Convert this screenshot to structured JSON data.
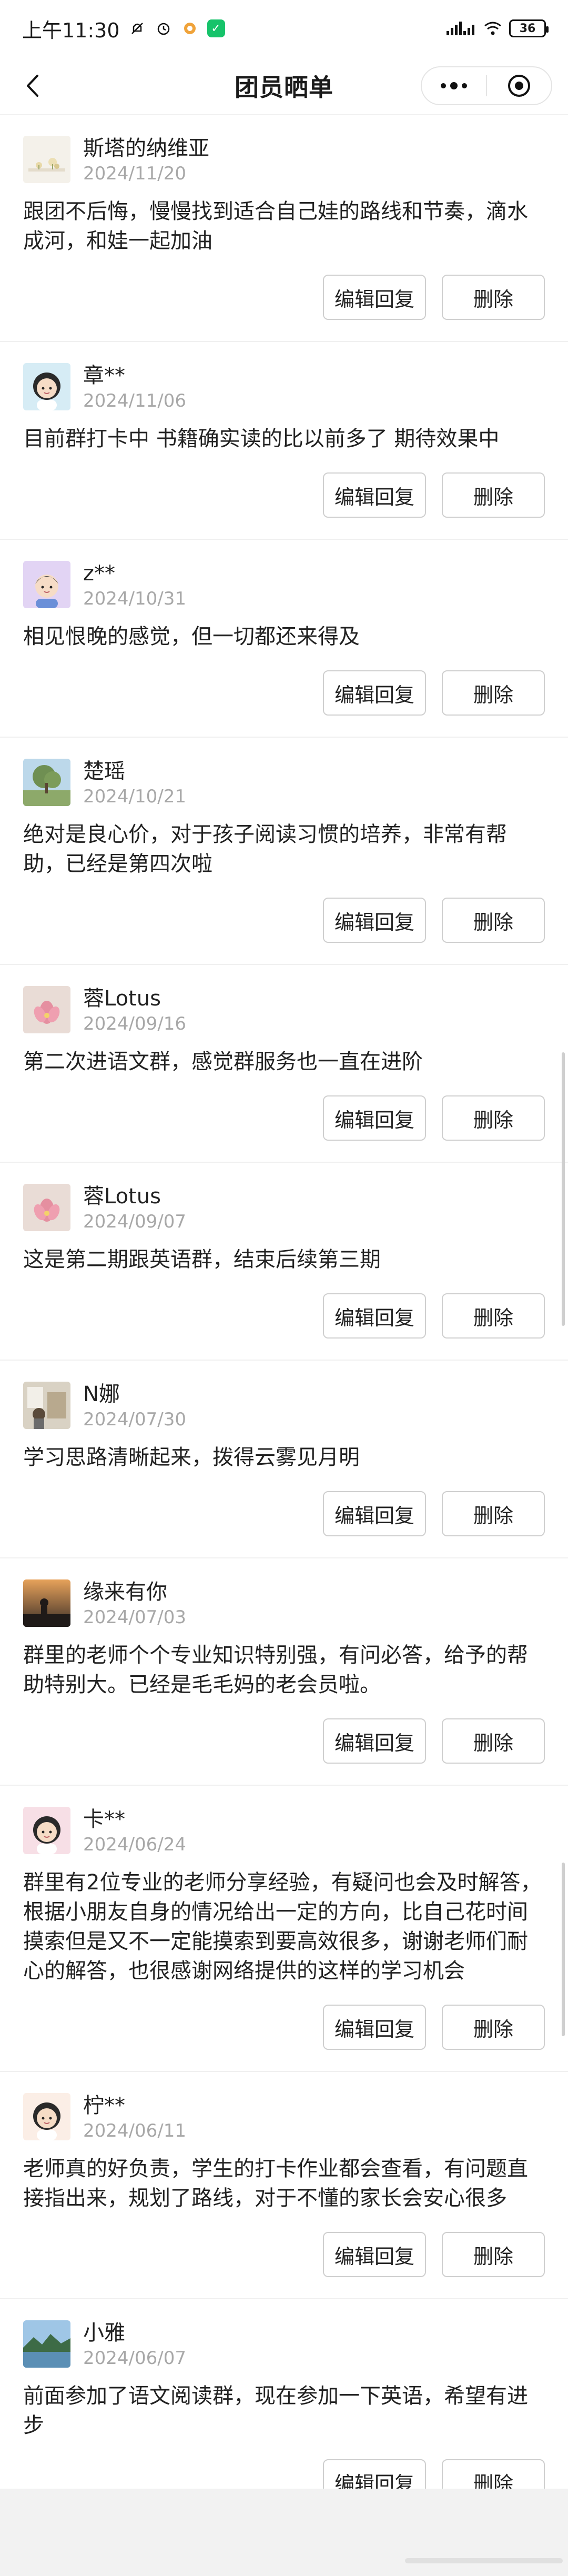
{
  "status_bar": {
    "time": "上午11:30",
    "battery": "36"
  },
  "nav": {
    "title": "团员晒单"
  },
  "buttons": {
    "edit_reply": "编辑回复",
    "delete": "删除"
  },
  "reviews": [
    {
      "name": "斯塔的纳维亚",
      "date": "2024/11/20",
      "text": "跟团不后悔，慢慢找到适合自己娃的路线和节奏，滴水成河，和娃一起加油",
      "avatar": "flowers-avatar"
    },
    {
      "name": "章**",
      "date": "2024/11/06",
      "text": "目前群打卡中 书籍确实读的比以前多了 期待效果中",
      "avatar": "cartoon-girl-avatar"
    },
    {
      "name": "z**",
      "date": "2024/10/31",
      "text": "相见恨晚的感觉，但一切都还来得及",
      "avatar": "cartoon-boy-avatar"
    },
    {
      "name": "楚瑶",
      "date": "2024/10/21",
      "text": "绝对是良心价，对于孩子阅读习惯的培养，非常有帮助，已经是第四次啦",
      "avatar": "tree-landscape-avatar"
    },
    {
      "name": "蓉Lotus",
      "date": "2024/09/16",
      "text": "第二次进语文群，感觉群服务也一直在进阶",
      "avatar": "lotus-avatar"
    },
    {
      "name": "蓉Lotus",
      "date": "2024/09/07",
      "text": "这是第二期跟英语群，结束后续第三期",
      "avatar": "lotus-avatar"
    },
    {
      "name": "N娜",
      "date": "2024/07/30",
      "text": "学习思路清晰起来，拨得云雾见月明",
      "avatar": "room-photo-avatar"
    },
    {
      "name": "缘来有你",
      "date": "2024/07/03",
      "text": "群里的老师个个专业知识特别强，有问必答，给予的帮助特别大。已经是毛毛妈的老会员啦。",
      "avatar": "sunset-silhouette-avatar"
    },
    {
      "name": "卡**",
      "date": "2024/06/24",
      "text": "群里有2位专业的老师分享经验，有疑问也会及时解答，根据小朋友自身的情况给出一定的方向，比自己花时间摸索但是又不一定能摸索到要高效很多，谢谢老师们耐心的解答，也很感谢网络提供的这样的学习机会",
      "avatar": "cartoon-girl-avatar"
    },
    {
      "name": "柠**",
      "date": "2024/06/11",
      "text": "老师真的好负责，学生的打卡作业都会查看，有问题直接指出来，规划了路线，对于不懂的家长会安心很多",
      "avatar": "cartoon-girl-avatar"
    },
    {
      "name": "小雅",
      "date": "2024/06/07",
      "text": "前面参加了语文阅读群，现在参加一下英语，希望有进步",
      "avatar": "lake-landscape-avatar"
    }
  ]
}
